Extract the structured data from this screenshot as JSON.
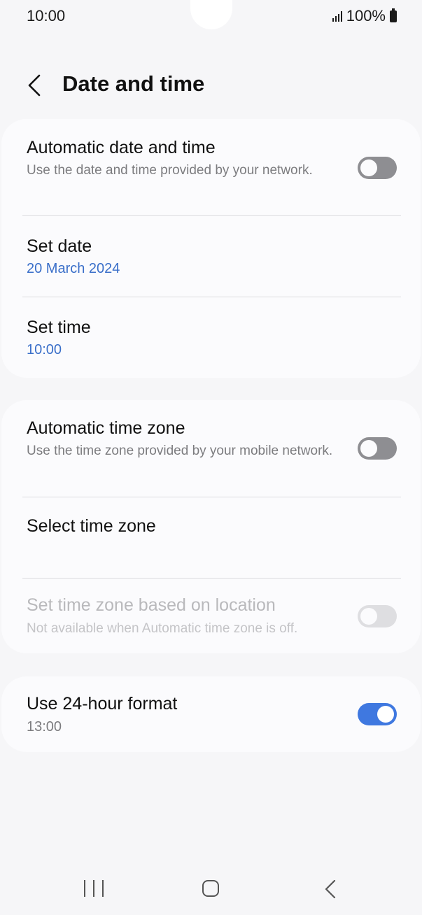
{
  "status_bar": {
    "time": "10:00",
    "battery": "100%",
    "icons": [
      "signal-icon",
      "battery-icon"
    ]
  },
  "header": {
    "title": "Date and time",
    "back_icon": "chevron-left-icon"
  },
  "card1": {
    "automatic_date_time": {
      "title": "Automatic date and time",
      "subtitle": "Use the date and time provided by your network.",
      "toggle": "off"
    },
    "set_date": {
      "title": "Set date",
      "value": "20 March 2024"
    },
    "set_time": {
      "title": "Set time",
      "value": "10:00"
    }
  },
  "card2": {
    "automatic_time_zone": {
      "title": "Automatic time zone",
      "subtitle": "Use the time zone provided by your mobile network.",
      "toggle": "off"
    },
    "select_time_zone": {
      "title": "Select time zone"
    },
    "location_time_zone": {
      "title": "Set time zone based on location",
      "subtitle": "Not available when Automatic time zone is off.",
      "toggle": "disabled"
    }
  },
  "card3": {
    "use_24_hour": {
      "title": "Use 24-hour format",
      "value": "13:00",
      "toggle": "on"
    }
  },
  "nav_bar": {
    "icons": [
      "recent-apps-icon",
      "home-icon",
      "back-icon"
    ]
  },
  "colors": {
    "background": "#f6f6f8",
    "card": "#fbfbfd",
    "accent": "#3f78e0",
    "link_value": "#3a6fc9",
    "secondary_text": "#7c7c7f"
  }
}
